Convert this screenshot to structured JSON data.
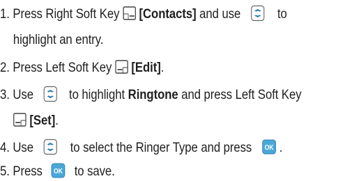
{
  "instructions": {
    "steps": [
      {
        "number": "1.",
        "a": "Press Right Soft Key",
        "b": "[Contacts]",
        "c": "and use",
        "d": "to",
        "e": "highlight an entry."
      },
      {
        "number": "2.",
        "a": "Press Left Soft Key",
        "b": "[Edit]",
        "c": "."
      },
      {
        "number": "3.",
        "a": "Use",
        "b": "to highlight",
        "c": "Ringtone",
        "d": "and press Left Soft Key",
        "e": "[Set]",
        "f": "."
      },
      {
        "number": "4.",
        "a": "Use",
        "b": "to select the Ringer Type and press",
        "c": "."
      },
      {
        "number": "5.",
        "a": "Press",
        "b": "to save."
      }
    ]
  },
  "icons": {
    "ok_label": "OK",
    "ok_color": "#4aa8d8",
    "nav_color": "#56a9d6"
  }
}
